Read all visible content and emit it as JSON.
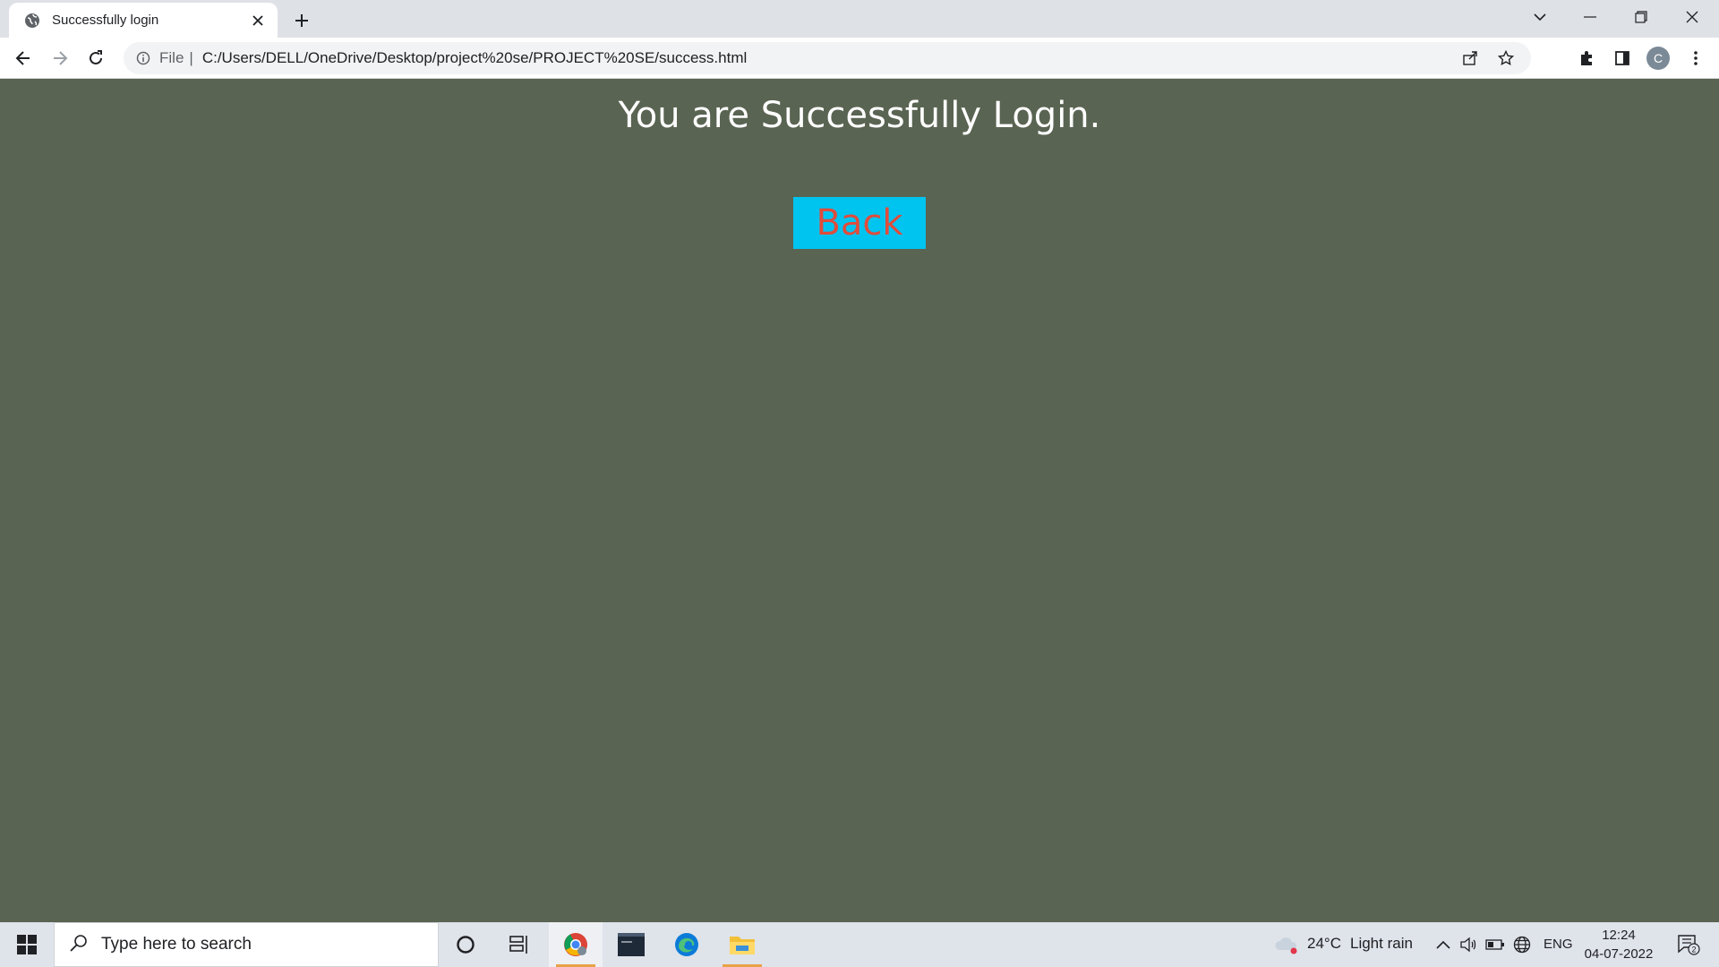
{
  "browser": {
    "tab_title": "Successfully login",
    "url_scheme_label": "File",
    "url_separator": "|",
    "url": "C:/Users/DELL/OneDrive/Desktop/project%20se/PROJECT%20SE/success.html",
    "profile_initial": "C"
  },
  "page": {
    "heading": "You are Successfully Login.",
    "back_button": "Back",
    "background_color": "#5a6452",
    "button_color": "#00c4f0",
    "button_text_color": "#e04c3c"
  },
  "taskbar": {
    "search_placeholder": "Type here to search",
    "pinned_apps": [
      "chrome-icon",
      "mysql-terminal-icon",
      "edge-icon",
      "file-explorer-icon"
    ],
    "weather_temp": "24°C",
    "weather_desc": "Light rain",
    "language": "ENG",
    "time": "12:24",
    "date": "04-07-2022",
    "notification_count": "2"
  }
}
